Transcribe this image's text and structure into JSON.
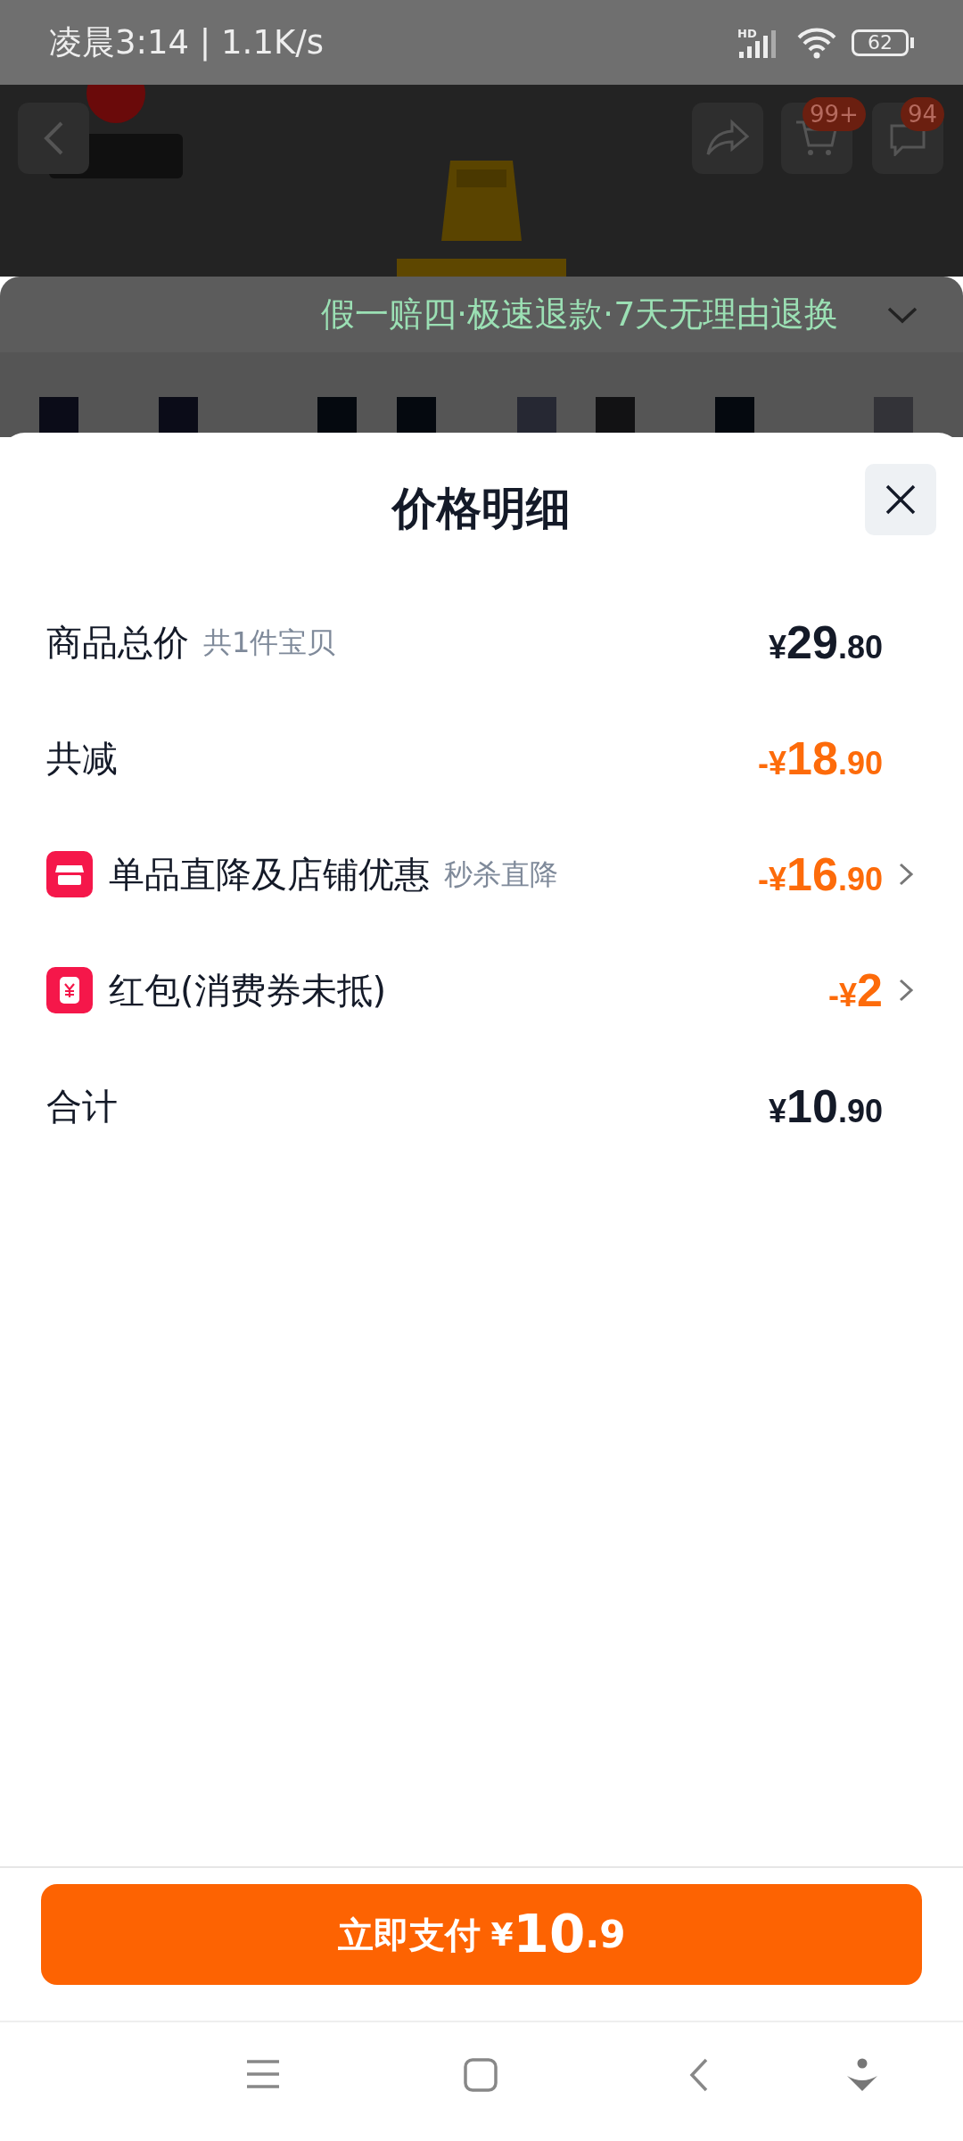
{
  "status_bar": {
    "time_speed": "凌晨3:14 | 1.1K/s",
    "network": "HD",
    "battery": "62"
  },
  "background_page": {
    "cart_badge": "99+",
    "message_badge": "94",
    "guarantee": "假一赔四·极速退款·7天无理由退换"
  },
  "sheet": {
    "title": "价格明细",
    "rows": [
      {
        "label": "商品总价",
        "note": "共1件宝贝",
        "kind": "plain",
        "discount": false,
        "sign": "",
        "currency": "¥",
        "integer": "29",
        "decimal": ".80",
        "has_link": false
      },
      {
        "label": "共减",
        "note": "",
        "kind": "plain",
        "discount": true,
        "sign": "-",
        "currency": "¥",
        "integer": "18",
        "decimal": ".90",
        "has_link": false
      },
      {
        "label": "单品直降及店铺优惠",
        "note": "秒杀直降",
        "kind": "store",
        "discount": true,
        "sign": "-",
        "currency": "¥",
        "integer": "16",
        "decimal": ".90",
        "has_link": true
      },
      {
        "label": "红包(消费券未抵)",
        "note": "",
        "kind": "packet",
        "discount": true,
        "sign": "-",
        "currency": "¥",
        "integer": "2",
        "decimal": "",
        "has_link": true
      },
      {
        "label": "合计",
        "note": "",
        "kind": "plain",
        "discount": false,
        "sign": "",
        "currency": "¥",
        "integer": "10",
        "decimal": ".90",
        "has_link": false
      }
    ]
  },
  "pay_button": {
    "label": "立即支付",
    "currency": "¥",
    "integer": "10",
    "decimal": ".9"
  }
}
